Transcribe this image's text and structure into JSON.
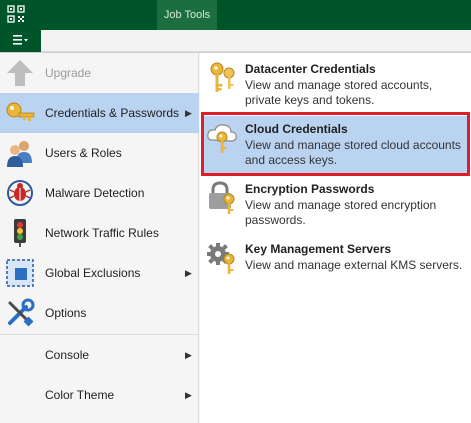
{
  "titlebar": {
    "job_tools_tab": "Job Tools",
    "app_icon": "qr-grid-icon"
  },
  "ribbon": {
    "menu_button_icon": "hamburger-dropdown-icon"
  },
  "left_menu": {
    "items": [
      {
        "label": "Upgrade",
        "icon": "upgrade-arrow-icon",
        "disabled": true,
        "has_submenu": false
      },
      {
        "label": "Credentials & Passwords",
        "icon": "key-icon",
        "active": true,
        "has_submenu": true
      },
      {
        "label": "Users & Roles",
        "icon": "users-icon",
        "has_submenu": false
      },
      {
        "label": "Malware Detection",
        "icon": "malware-bug-icon",
        "has_submenu": false
      },
      {
        "label": "Network Traffic Rules",
        "icon": "traffic-light-icon",
        "has_submenu": false
      },
      {
        "label": "Global Exclusions",
        "icon": "exclusions-icon",
        "has_submenu": true
      },
      {
        "label": "Options",
        "icon": "wrench-screwdriver-icon",
        "has_submenu": false
      },
      {
        "label": "Console",
        "icon": "",
        "has_submenu": true
      },
      {
        "label": "Color Theme",
        "icon": "",
        "has_submenu": true
      }
    ]
  },
  "submenu": {
    "items": [
      {
        "title": "Datacenter Credentials",
        "description": "View and manage stored accounts, private keys and tokens.",
        "icon": "keys-icon"
      },
      {
        "title": "Cloud Credentials",
        "description": "View and manage stored cloud accounts and access keys.",
        "icon": "cloud-key-icon",
        "highlighted": true
      },
      {
        "title": "Encryption Passwords",
        "description": "View and manage stored encryption passwords.",
        "icon": "lock-key-icon"
      },
      {
        "title": "Key Management Servers",
        "description": "View and manage external KMS servers.",
        "icon": "gear-key-icon"
      }
    ]
  },
  "colors": {
    "titlebar": "#00542a",
    "active_item": "#b9d3f1",
    "highlight_border": "#e01e2a",
    "key_gold": "#e9b53c"
  }
}
